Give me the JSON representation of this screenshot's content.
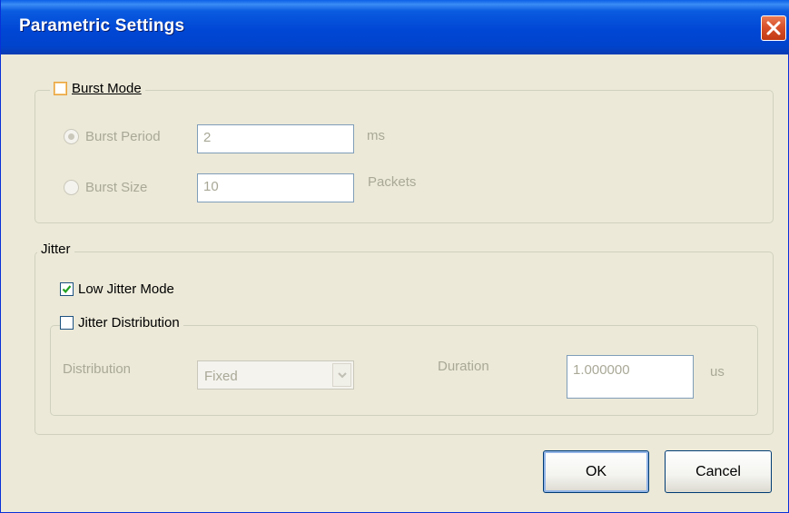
{
  "window": {
    "title": "Parametric Settings",
    "close_icon": "close-icon"
  },
  "burst_group": {
    "legend": "Burst Mode",
    "checked": false,
    "burst_period": {
      "label": "Burst Period",
      "selected": true,
      "value": "2",
      "unit": "ms"
    },
    "burst_size": {
      "label": "Burst Size",
      "selected": false,
      "value": "10",
      "unit": "Packets"
    }
  },
  "jitter_group": {
    "legend": "Jitter",
    "low_jitter": {
      "label": "Low Jitter Mode",
      "checked": true
    },
    "distribution_group": {
      "legend": "Jitter Distribution",
      "checked": false,
      "distribution_label": "Distribution",
      "distribution_value": "Fixed",
      "duration_label": "Duration",
      "duration_value": "1.000000",
      "duration_unit": "us"
    }
  },
  "buttons": {
    "ok": "OK",
    "cancel": "Cancel"
  },
  "colors": {
    "titlebar": "#0047d5",
    "close": "#d8512a",
    "dialog_bg": "#ece9d8",
    "disabled_text": "#a9a897"
  }
}
